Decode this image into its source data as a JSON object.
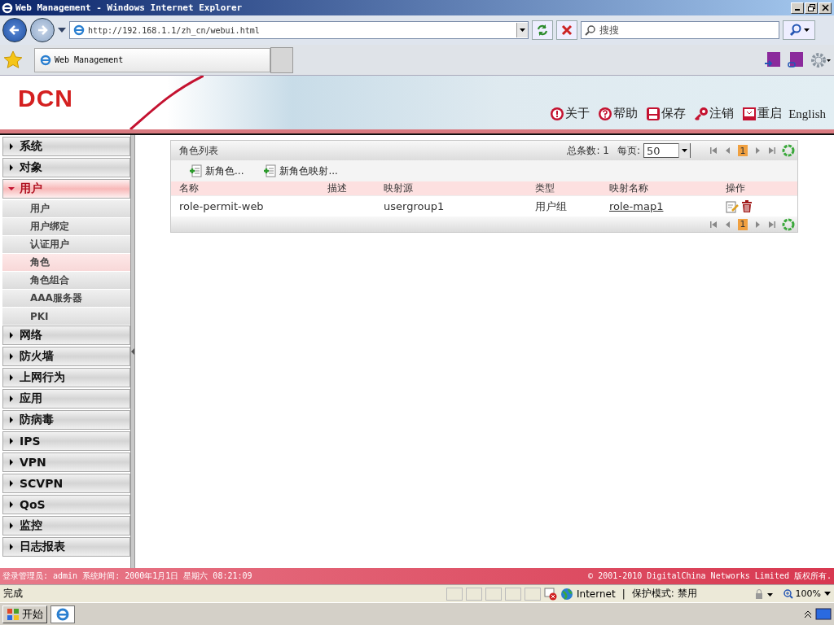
{
  "window": {
    "title": "Web Management - Windows Internet Explorer"
  },
  "browser": {
    "address": "http://192.168.1.1/zh_cn/webui.html",
    "search_placeholder": "搜搜",
    "tab": "Web Management"
  },
  "header": {
    "logo": "DCN",
    "actions": [
      {
        "kind": "about",
        "label": "关于"
      },
      {
        "kind": "help",
        "label": "帮助"
      },
      {
        "kind": "save",
        "label": "保存"
      },
      {
        "kind": "logout",
        "label": "注销"
      },
      {
        "kind": "reboot",
        "label": "重启"
      }
    ],
    "language": "English"
  },
  "sidebar": {
    "items": [
      {
        "label": "系统",
        "expanded": false
      },
      {
        "label": "对象",
        "expanded": false
      },
      {
        "label": "用户",
        "expanded": true,
        "children": [
          {
            "label": "用户",
            "selected": false
          },
          {
            "label": "用户绑定",
            "selected": false
          },
          {
            "label": "认证用户",
            "selected": false
          },
          {
            "label": "角色",
            "selected": true
          },
          {
            "label": "角色组合",
            "selected": false
          },
          {
            "label": "AAA服务器",
            "selected": false
          },
          {
            "label": "PKI",
            "selected": false
          }
        ]
      },
      {
        "label": "网络",
        "expanded": false
      },
      {
        "label": "防火墙",
        "expanded": false
      },
      {
        "label": "上网行为",
        "expanded": false
      },
      {
        "label": "应用",
        "expanded": false
      },
      {
        "label": "防病毒",
        "expanded": false
      },
      {
        "label": "IPS",
        "expanded": false
      },
      {
        "label": "VPN",
        "expanded": false
      },
      {
        "label": "SCVPN",
        "expanded": false
      },
      {
        "label": "QoS",
        "expanded": false
      },
      {
        "label": "监控",
        "expanded": false
      },
      {
        "label": "日志报表",
        "expanded": false
      }
    ]
  },
  "panel": {
    "title": "角色列表",
    "total": "总条数: 1",
    "per_page_label": "每页:",
    "per_page": "50",
    "page": "1",
    "bottom_page": "1",
    "toolbar": [
      "新角色...",
      "新角色映射..."
    ],
    "columns": [
      "名称",
      "描述",
      "映射源",
      "类型",
      "映射名称",
      "操作"
    ],
    "rows": [
      {
        "name": "role-permit-web",
        "source": "usergroup1",
        "type": "用户组",
        "map_name": "role-map1"
      }
    ]
  },
  "footer": {
    "left": "登录管理员: admin 系统时间: 2000年1月1日 星期六 08:21:09",
    "right": "© 2001-2010 DigitalChina Networks Limited 版权所有."
  },
  "status_bar": {
    "text": "完成",
    "zone": "Internet",
    "separator": "|",
    "protected_mode": "保护模式: 禁用",
    "zoom": "100%"
  },
  "taskbar": {
    "start": "开始"
  }
}
